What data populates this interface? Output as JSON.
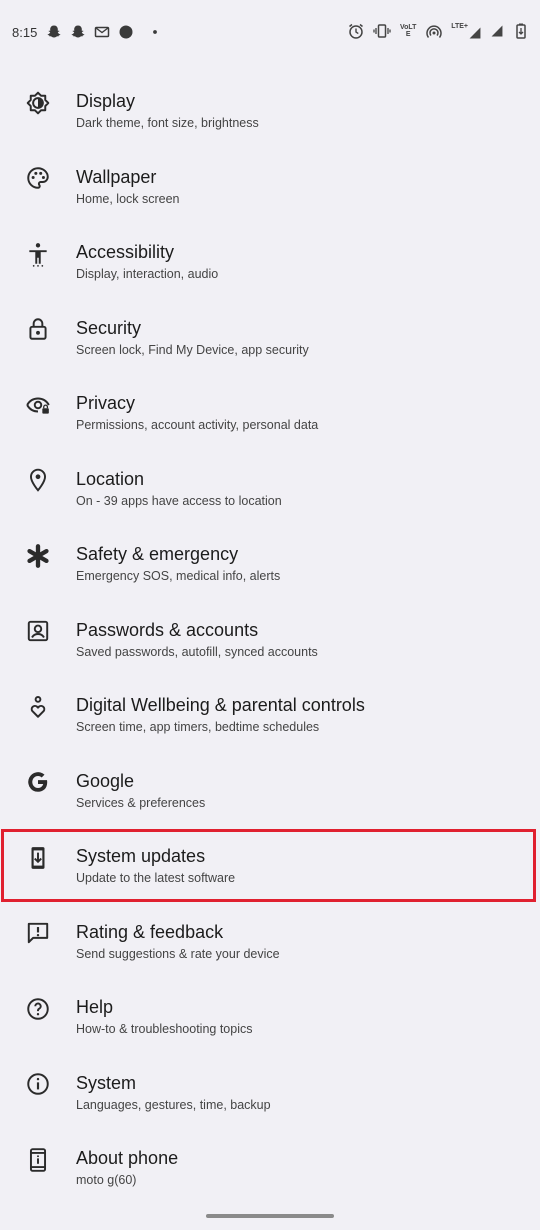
{
  "status_bar": {
    "time": "8:15",
    "left_icons": [
      "snapchat-icon",
      "snapchat-icon",
      "message-icon",
      "circle-icon",
      "dot-icon"
    ],
    "right_icons": [
      "alarm-icon",
      "vibrate-icon",
      "volte-icon",
      "hotspot-icon",
      "signal-lte-icon",
      "signal-icon",
      "battery-icon"
    ],
    "volte_label": "VoLTE",
    "lte_label": "LTE+"
  },
  "settings": {
    "items": [
      {
        "title": "Display",
        "subtitle": "Dark theme, font size, brightness",
        "icon": "display-brightness-icon"
      },
      {
        "title": "Wallpaper",
        "subtitle": "Home, lock screen",
        "icon": "palette-icon"
      },
      {
        "title": "Accessibility",
        "subtitle": "Display, interaction, audio",
        "icon": "accessibility-icon"
      },
      {
        "title": "Security",
        "subtitle": "Screen lock, Find My Device, app security",
        "icon": "lock-icon"
      },
      {
        "title": "Privacy",
        "subtitle": "Permissions, account activity, personal data",
        "icon": "privacy-eye-icon"
      },
      {
        "title": "Location",
        "subtitle": "On - 39 apps have access to location",
        "icon": "location-pin-icon"
      },
      {
        "title": "Safety & emergency",
        "subtitle": "Emergency SOS, medical info, alerts",
        "icon": "asterisk-icon"
      },
      {
        "title": "Passwords & accounts",
        "subtitle": "Saved passwords, autofill, synced accounts",
        "icon": "account-box-icon"
      },
      {
        "title": "Digital Wellbeing & parental controls",
        "subtitle": "Screen time, app timers, bedtime schedules",
        "icon": "wellbeing-heart-icon"
      },
      {
        "title": "Google",
        "subtitle": "Services & preferences",
        "icon": "google-g-icon"
      },
      {
        "title": "System updates",
        "subtitle": "Update to the latest software",
        "icon": "system-update-icon"
      },
      {
        "title": "Rating & feedback",
        "subtitle": "Send suggestions & rate your device",
        "icon": "feedback-icon"
      },
      {
        "title": "Help",
        "subtitle": "How-to & troubleshooting topics",
        "icon": "help-icon"
      },
      {
        "title": "System",
        "subtitle": "Languages, gestures, time, backup",
        "icon": "info-icon"
      },
      {
        "title": "About phone",
        "subtitle": "moto g(60)",
        "icon": "phone-info-icon"
      }
    ]
  },
  "highlight": {
    "target": "System updates",
    "color": "#e0202f"
  },
  "colors": {
    "background": "#f1f0f5",
    "icon": "#2b2b2b"
  }
}
